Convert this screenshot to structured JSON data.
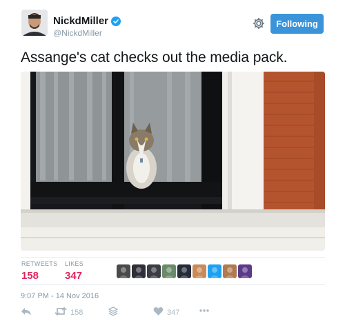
{
  "user": {
    "display_name": "NickdMiller",
    "handle": "@NickdMiller",
    "verified": true,
    "follow_label": "Following",
    "follow_color": "#3b94d9"
  },
  "tweet": {
    "text": "Assange's cat checks out the media pack.",
    "timestamp": "9:07 PM - 14 Nov 2016"
  },
  "stats": {
    "retweets_label": "RETWEETS",
    "retweets_value": "158",
    "likes_label": "LIKES",
    "likes_value": "347",
    "value_color": "#e0245e"
  },
  "likers": [
    {
      "icon": "liker-avatar",
      "color": "#4a4a4a"
    },
    {
      "icon": "liker-avatar",
      "color": "#2f2f3a"
    },
    {
      "icon": "liker-avatar",
      "color": "#3a3d45"
    },
    {
      "icon": "liker-avatar",
      "color": "#6a8a6a"
    },
    {
      "icon": "liker-avatar",
      "color": "#252c3a"
    },
    {
      "icon": "liker-avatar",
      "color": "#c98a5a"
    },
    {
      "icon": "liker-avatar",
      "color": "#1da1f2"
    },
    {
      "icon": "liker-avatar",
      "color": "#b07a50"
    },
    {
      "icon": "liker-avatar",
      "color": "#5b3a8a"
    }
  ],
  "actions": {
    "reply_icon": "reply-icon",
    "retweet_icon": "retweet-icon",
    "retweet_count": "158",
    "stack_icon": "stack-icon",
    "like_icon": "heart-icon",
    "like_count": "347",
    "more_icon": "more-icon"
  }
}
